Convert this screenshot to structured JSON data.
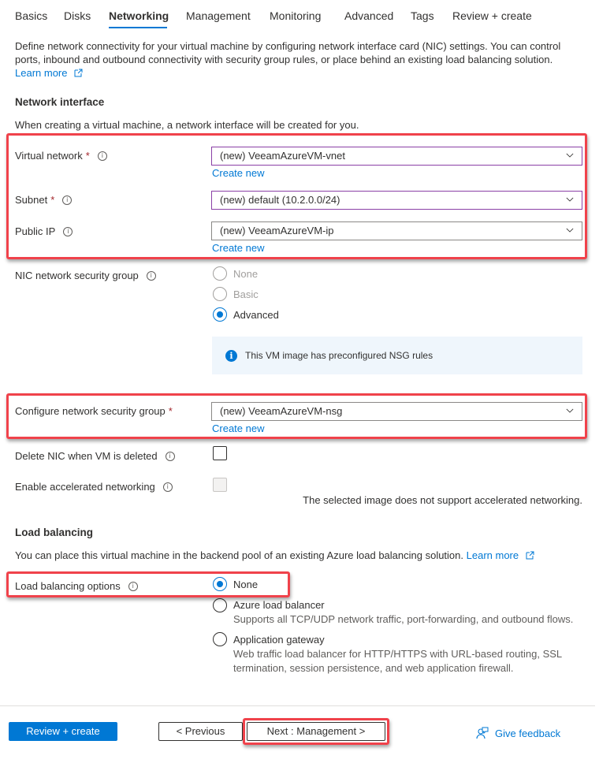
{
  "tabs": [
    {
      "label": "Basics",
      "active": false
    },
    {
      "label": "Disks",
      "active": false
    },
    {
      "label": "Networking",
      "active": true
    },
    {
      "label": "Management",
      "active": false
    },
    {
      "label": "Monitoring",
      "active": false
    },
    {
      "label": "Advanced",
      "active": false
    },
    {
      "label": "Tags",
      "active": false
    },
    {
      "label": "Review + create",
      "active": false
    }
  ],
  "intro": {
    "line1": "Define network connectivity for your virtual machine by configuring network interface card (NIC) settings. You can control",
    "line2": "ports, inbound and outbound connectivity with security group rules, or place behind an existing load balancing solution.",
    "learn_more": "Learn more"
  },
  "network_interface": {
    "title": "Network interface",
    "description": "When creating a virtual machine, a network interface will be created for you.",
    "virtual_network": {
      "label": "Virtual network",
      "required": "*",
      "value": "(new) VeeamAzureVM-vnet",
      "create_new": "Create new"
    },
    "subnet": {
      "label": "Subnet",
      "required": "*",
      "value": "(new) default (10.2.0.0/24)"
    },
    "public_ip": {
      "label": "Public IP",
      "value": "(new) VeeamAzureVM-ip",
      "create_new": "Create new"
    },
    "nic_nsg": {
      "label": "NIC network security group",
      "options": [
        {
          "label": "None",
          "selected": false,
          "disabled": true
        },
        {
          "label": "Basic",
          "selected": false,
          "disabled": true
        },
        {
          "label": "Advanced",
          "selected": true,
          "disabled": false
        }
      ],
      "info_message": "This VM image has preconfigured NSG rules"
    },
    "configure_nsg": {
      "label": "Configure network security group",
      "required": "*",
      "value": "(new) VeeamAzureVM-nsg",
      "create_new": "Create new"
    },
    "delete_nic": {
      "label": "Delete NIC when VM is deleted",
      "checked": false
    },
    "accelerated": {
      "label": "Enable accelerated networking",
      "checked": false,
      "disabled": true,
      "note": "The selected image does not support accelerated networking."
    }
  },
  "load_balancing": {
    "title": "Load balancing",
    "description": "You can place this virtual machine in the backend pool of an existing Azure load balancing solution.",
    "learn_more": "Learn more",
    "options_label": "Load balancing options",
    "options": [
      {
        "label": "None",
        "selected": true,
        "description": ""
      },
      {
        "label": "Azure load balancer",
        "selected": false,
        "description": "Supports all TCP/UDP network traffic, port-forwarding, and outbound flows."
      },
      {
        "label": "Application gateway",
        "selected": false,
        "description_line1": "Web traffic load balancer for HTTP/HTTPS with URL-based routing, SSL",
        "description_line2": "termination, session persistence, and web application firewall."
      }
    ]
  },
  "footer": {
    "review_create": "Review + create",
    "previous": "< Previous",
    "next": "Next : Management >",
    "feedback": "Give feedback"
  },
  "colors": {
    "accent": "#0078d4",
    "highlight": "#f0424b",
    "required": "#a4262c",
    "focus_border": "#8a3fa6"
  }
}
